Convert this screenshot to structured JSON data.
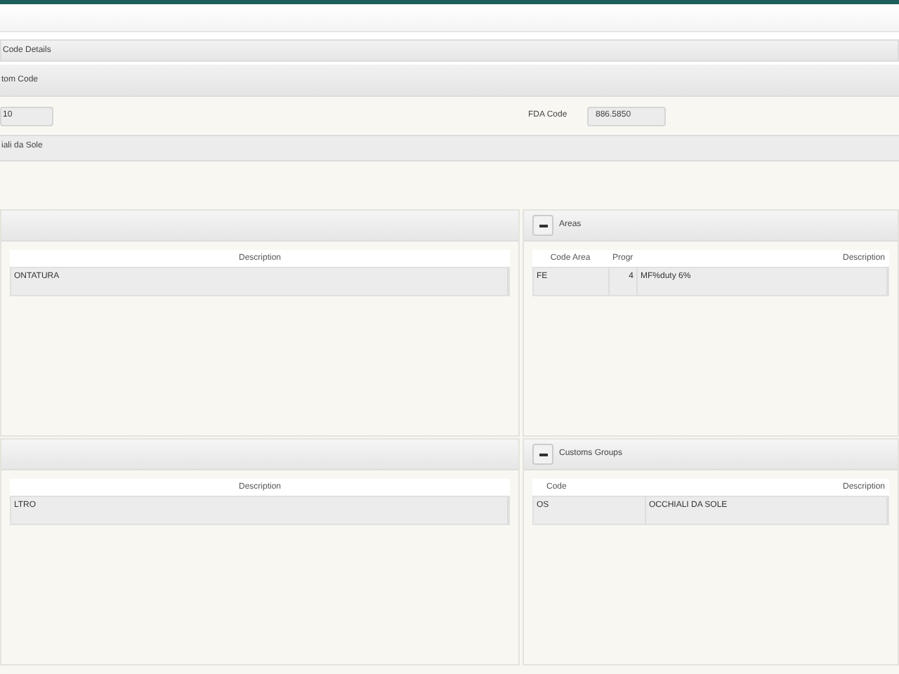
{
  "section_title": "Code Details",
  "subsection_title": "tom Code",
  "code_field": {
    "value": "10"
  },
  "fda_field": {
    "label": "FDA Code",
    "value": "886.5850"
  },
  "description_bar": "iali da Sole",
  "panels": [
    {
      "columns": [
        "Description"
      ],
      "rows": [
        [
          "ONTATURA"
        ]
      ]
    },
    {
      "title": "Areas",
      "expanded": true,
      "columns": [
        "Code Area",
        "Progr",
        "Description"
      ],
      "rows": [
        [
          "FE",
          "4",
          "MF%duty 6%"
        ]
      ]
    },
    {
      "columns": [
        "Description"
      ],
      "rows": [
        [
          "LTRO"
        ]
      ]
    },
    {
      "title": "Customs Groups",
      "expanded": true,
      "columns": [
        "Code",
        "Description"
      ],
      "rows": [
        [
          "OS",
          "OCCHIALI DA SOLE"
        ]
      ]
    }
  ]
}
